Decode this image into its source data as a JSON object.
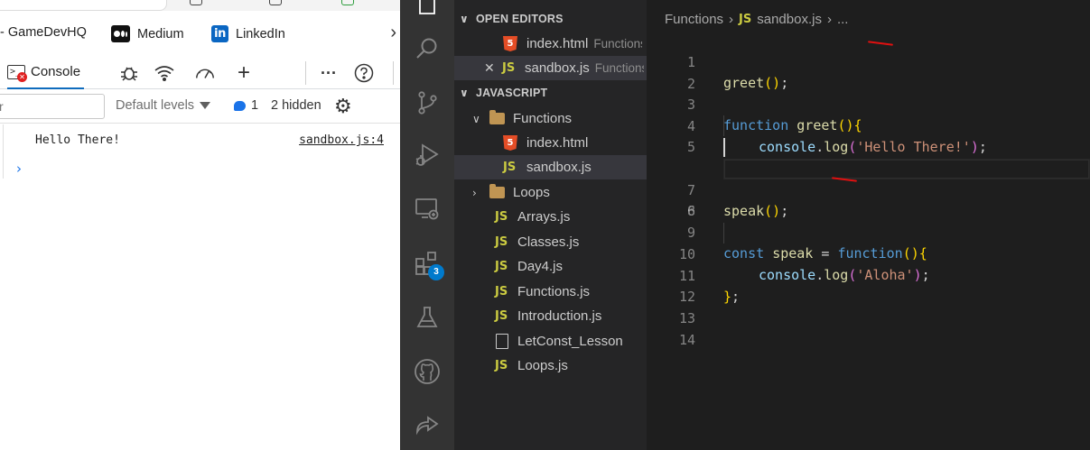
{
  "browser": {
    "bookmarks": [
      {
        "label": "- GameDevHQ",
        "icon": "bookmark-icon"
      },
      {
        "label": "Medium",
        "icon": "medium-logo-icon"
      },
      {
        "label": "LinkedIn",
        "icon": "linkedin-logo-icon"
      }
    ],
    "devtools": {
      "active_tab": "Console",
      "filter_placeholder": "r",
      "levels_label": "Default levels",
      "issues_count": "1",
      "hidden_label": "2 hidden",
      "console_messages": [
        {
          "text": "Hello There!",
          "source": "sandbox.js:4"
        }
      ],
      "prompt": "›"
    }
  },
  "vscode": {
    "extensions_badge": "3",
    "open_editors_title": "OPEN EDITORS",
    "open_editors": [
      {
        "name": "index.html",
        "desc": "Functions",
        "type": "html"
      },
      {
        "name": "sandbox.js",
        "desc": "Functions",
        "type": "js",
        "close": "✕"
      }
    ],
    "workspace_title": "JAVASCRIPT",
    "tree": [
      {
        "name": "Functions",
        "kind": "folder-open"
      },
      {
        "name": "index.html",
        "kind": "html"
      },
      {
        "name": "sandbox.js",
        "kind": "js"
      },
      {
        "name": "Loops",
        "kind": "folder"
      },
      {
        "name": "Arrays.js",
        "kind": "js"
      },
      {
        "name": "Classes.js",
        "kind": "js"
      },
      {
        "name": "Day4.js",
        "kind": "js"
      },
      {
        "name": "Functions.js",
        "kind": "js"
      },
      {
        "name": "Introduction.js",
        "kind": "js"
      },
      {
        "name": "LetConst_Lesson",
        "kind": "file"
      },
      {
        "name": "Loops.js",
        "kind": "js"
      }
    ],
    "breadcrumb": {
      "folder": "Functions",
      "sep": "›",
      "file": "sandbox.js",
      "tail": "..."
    },
    "file_badge": "JS",
    "editor": {
      "line_numbers": [
        "1",
        "2",
        "3",
        "4",
        "5",
        "6",
        "7",
        "8",
        "9",
        "10",
        "11",
        "12",
        "13",
        "14"
      ],
      "active_line": "6",
      "code": {
        "l1_fn": "greet",
        "l3_kw": "function",
        "l3_fn": "greet",
        "l4_obj": "console",
        "l4_method": "log",
        "l4_str": "'Hello There!'",
        "l7_fn": "speak",
        "l9_kw": "const",
        "l9_name": "speak",
        "l9_op": "=",
        "l9_kw2": "function",
        "l10_obj": "console",
        "l10_method": "log",
        "l10_str": "'Aloha'"
      }
    }
  }
}
